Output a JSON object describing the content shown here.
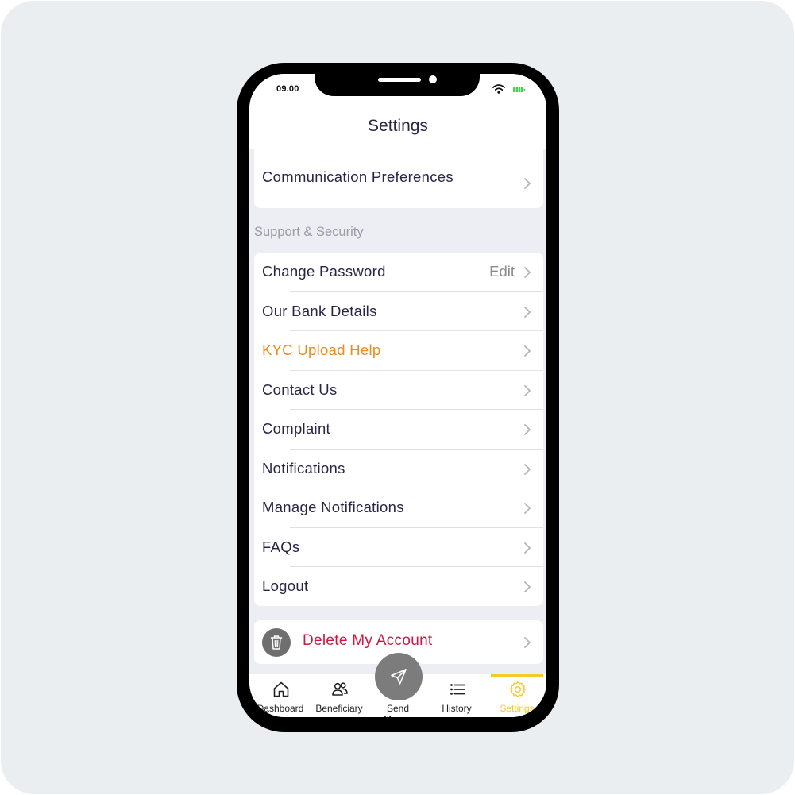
{
  "status_bar": {
    "time": "09.00"
  },
  "header": {
    "title": "Settings"
  },
  "top_card": {
    "label": "Communication Preferences"
  },
  "section": {
    "title": "Support & Security"
  },
  "security_items": [
    {
      "label": "Change Password",
      "value": "Edit"
    },
    {
      "label": "Our Bank Details"
    },
    {
      "label": "KYC Upload Help"
    },
    {
      "label": "Contact Us"
    },
    {
      "label": "Complaint"
    },
    {
      "label": "Notifications"
    },
    {
      "label": "Manage Notifications"
    },
    {
      "label": "FAQs"
    },
    {
      "label": "Logout"
    }
  ],
  "delete_account": {
    "label": "Delete My Account"
  },
  "tabbar": {
    "dashboard": "Dashboard",
    "beneficiary": "Beneficiary",
    "send": "Send Money",
    "history": "History",
    "settings": "Settings"
  },
  "colors": {
    "accent": "#f5c928",
    "kyc_text": "#f08a1c",
    "danger_text": "#d1173f",
    "text_primary": "#2a2545",
    "battery_green": "#3cd34a"
  }
}
